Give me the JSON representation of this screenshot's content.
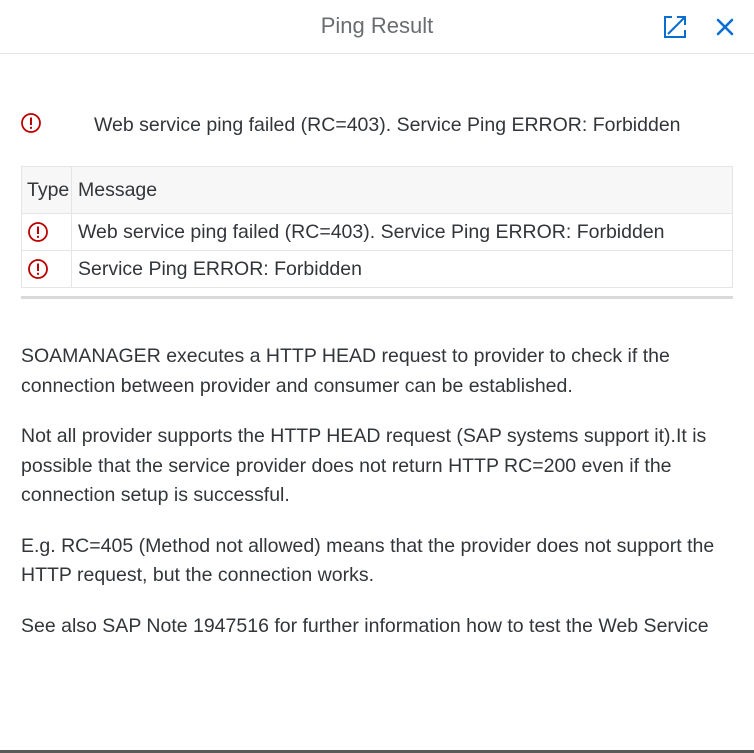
{
  "dialog": {
    "title": "Ping Result",
    "expand_icon": "expand-icon",
    "close_icon": "close-icon"
  },
  "summary": {
    "icon": "error-icon",
    "text": "Web service ping failed (RC=403). Service Ping ERROR: Forbidden"
  },
  "table": {
    "headers": [
      "Type",
      "Message"
    ],
    "rows": [
      {
        "type_icon": "error-icon",
        "message": "Web service ping failed (RC=403). Service Ping ERROR: Forbidden"
      },
      {
        "type_icon": "error-icon",
        "message": "Service Ping ERROR: Forbidden"
      }
    ]
  },
  "info": {
    "paragraphs": [
      "SOAMANAGER executes a HTTP HEAD request to provider to check if the connection between provider and consumer can be established.",
      "Not all provider supports the HTTP HEAD request (SAP systems support it).It is possible that the service provider does not return HTTP RC=200 even if the connection setup is successful.",
      "E.g. RC=405 (Method not allowed) means that the provider does not support the HTTP request, but the connection works.",
      "See also SAP Note 1947516 for further information how to test the Web Service"
    ]
  },
  "colors": {
    "error": "#bb0000",
    "accent": "#0a6ed1",
    "title": "#6a6d70",
    "text": "#32363a"
  }
}
